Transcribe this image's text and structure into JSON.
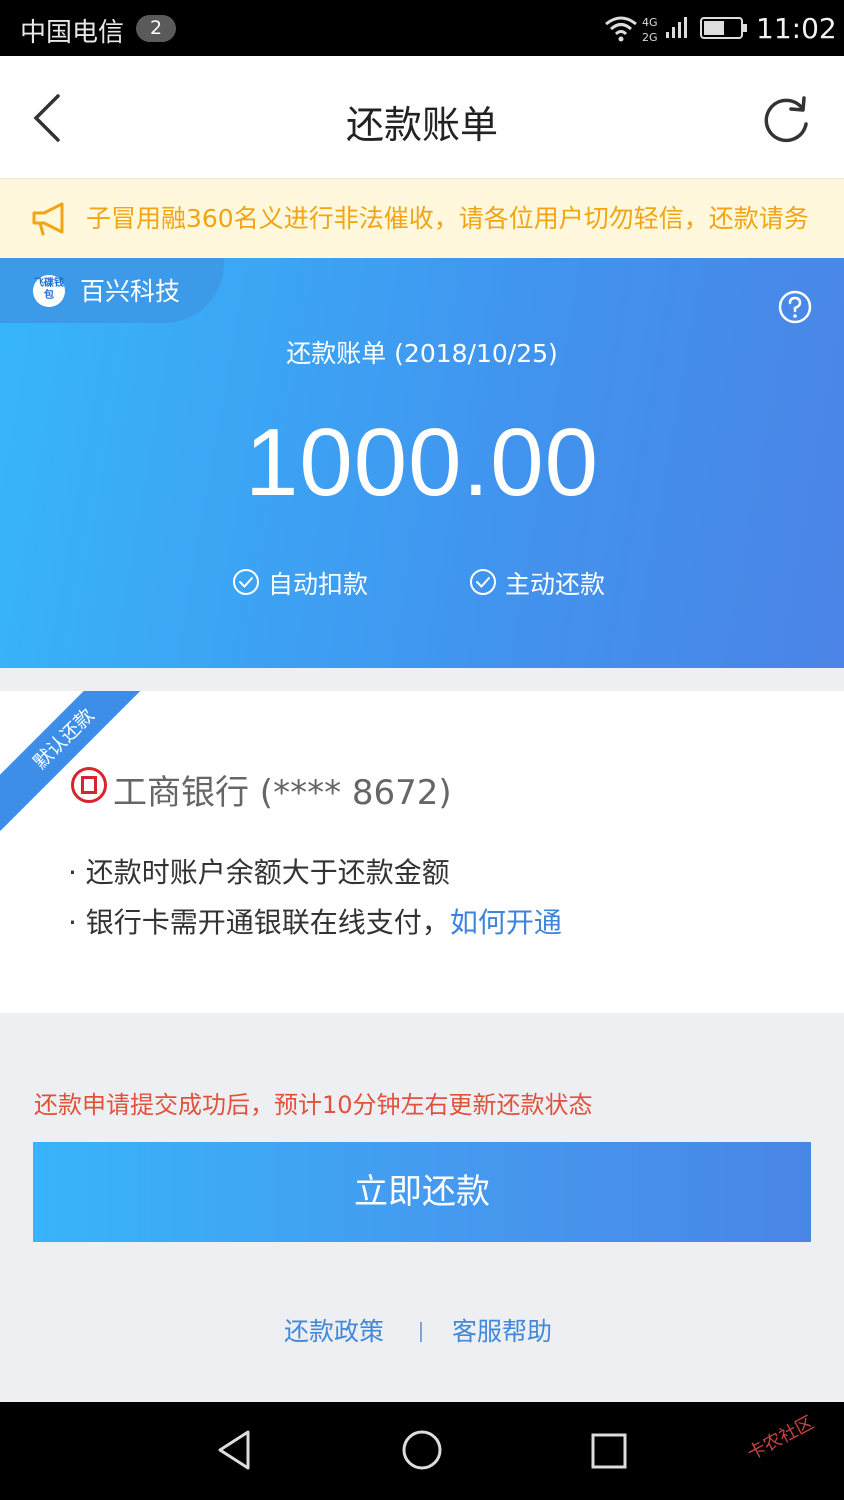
{
  "status_bar": {
    "carrier": "中国电信",
    "sim_badge": "2",
    "time": "11:02"
  },
  "nav": {
    "title": "还款账单"
  },
  "notice": {
    "text": "子冒用融360名义进行非法催收，请各位用户切勿轻信，还款请务"
  },
  "bill": {
    "merchant": "百兴科技",
    "merchant_logo_text": "飞碟钱包",
    "label": "还款账单 (2018/10/25)",
    "amount": "1000.00",
    "options": [
      "自动扣款",
      "主动还款"
    ]
  },
  "bank": {
    "default_tag": "默认还款",
    "name": "工商银行 (**** 8672)",
    "requirements": [
      "· 还款时账户余额大于还款金额",
      "· 银行卡需开通银联在线支付，"
    ],
    "link": "如何开通"
  },
  "footer": {
    "notice": "还款申请提交成功后，预计10分钟左右更新还款状态",
    "pay_button": "立即还款",
    "links": [
      "还款政策",
      "客服帮助"
    ]
  },
  "watermark": "卡农社区",
  "colors": {
    "accent": "#3d85dc",
    "warning": "#f2a413",
    "error": "#e0523c"
  }
}
